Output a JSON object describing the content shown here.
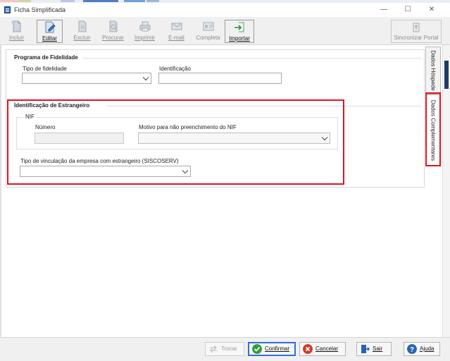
{
  "window": {
    "title": "Ficha Simplificada",
    "minimize": "—",
    "maximize": "☐",
    "close": "✕"
  },
  "toolbar": {
    "incluir": "Incluir",
    "editar": "Editar",
    "excluir": "Excluir",
    "procurar": "Procurar",
    "imprimir": "Imprimir",
    "email": "E-mail",
    "completa": "Completa",
    "importar": "Importar",
    "sincronizar": "Sincronizar Portal"
  },
  "fidelidade": {
    "group_title": "Programa de Fidelidade",
    "tipo_label": "Tipo de fidelidade",
    "tipo_value": "",
    "id_label": "Identificação",
    "id_value": ""
  },
  "estrangeiro": {
    "group_title": "Identificação de Estrangeiro",
    "nif_title": "NIF",
    "numero_label": "Número",
    "numero_value": "",
    "motivo_label": "Motivo para não preenchimento do NIF",
    "motivo_value": "",
    "vinculacao_label": "Tipo de vinculação da empresa com estrangeiro (SISCOSERV)",
    "vinculacao_value": ""
  },
  "side_tabs": {
    "dados_hospede": "Dados Hóspede",
    "dados_complementares": "Dados Complementares"
  },
  "buttons": {
    "trocar": "Trocar",
    "confirmar": "Confirmar",
    "cancelar": "Cancelar",
    "sair": "Sair",
    "ajuda": "Ajuda"
  },
  "colors": {
    "highlight": "#e0141e",
    "primary_border": "#2f6fd6",
    "confirm_green": "#2e9e3e",
    "cancel_red": "#d23a2a",
    "help_blue": "#2a64b0"
  },
  "icons": {
    "app": "app-form-icon",
    "incluir": "new-document-icon",
    "editar": "edit-document-icon",
    "excluir": "delete-document-icon",
    "procurar": "search-document-icon",
    "imprimir": "printer-icon",
    "email": "envelope-icon",
    "completa": "id-card-icon",
    "importar": "import-arrow-icon",
    "sincronizar": "sync-portal-icon",
    "trocar": "swap-icon",
    "confirmar": "check-circle-icon",
    "cancelar": "x-circle-icon",
    "sair": "exit-door-icon",
    "ajuda": "help-circle-icon"
  }
}
